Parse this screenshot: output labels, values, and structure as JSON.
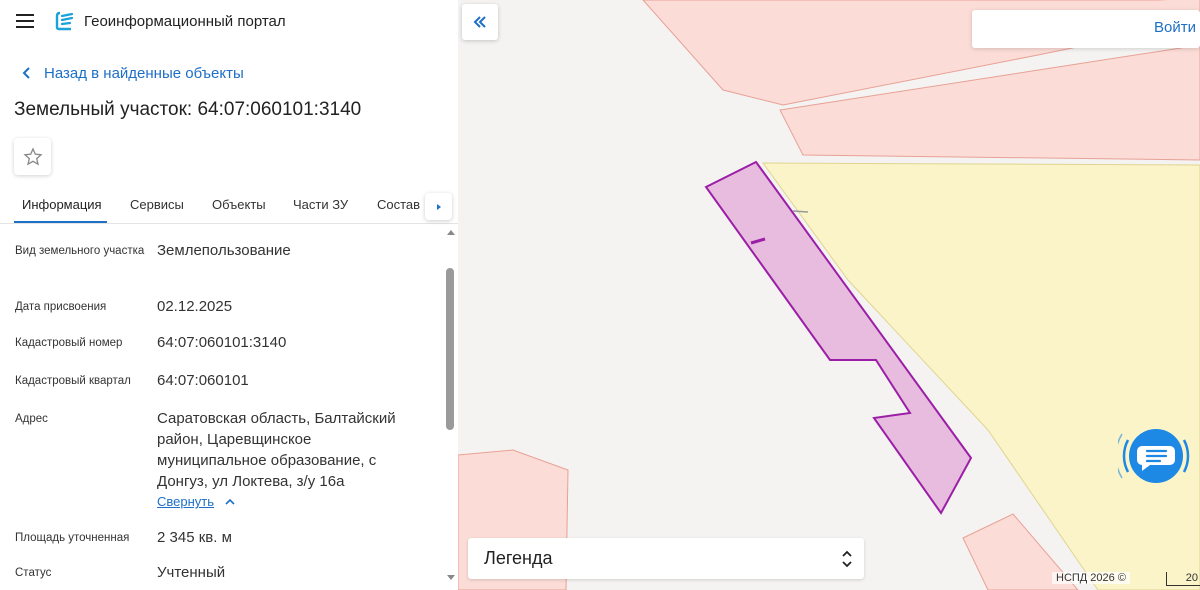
{
  "header": {
    "portal_title": "Геоинформационный портал"
  },
  "nav": {
    "back_label": "Назад в найденные объекты"
  },
  "object": {
    "title": "Земельный участок: 64:07:060101:3140"
  },
  "tabs": [
    {
      "label": "Информация",
      "active": true
    },
    {
      "label": "Сервисы",
      "active": false
    },
    {
      "label": "Объекты",
      "active": false
    },
    {
      "label": "Части ЗУ",
      "active": false
    },
    {
      "label": "Состав",
      "active": false
    }
  ],
  "properties": [
    {
      "label": "Вид земельного участка",
      "value": "Землепользование"
    },
    {
      "label": "Дата присвоения",
      "value": "02.12.2025"
    },
    {
      "label": "Кадастровый номер",
      "value": "64:07:060101:3140"
    },
    {
      "label": "Кадастровый квартал",
      "value": "64:07:060101"
    },
    {
      "label": "Адрес",
      "value": "Саратовская область, Балтайский район, Царевщинское муниципальное образование, с Донгуз, ул Локтева, з/у 16а"
    },
    {
      "label": "Площадь уточненная",
      "value": "2 345 кв. м"
    },
    {
      "label": "Статус",
      "value": "Учтенный"
    }
  ],
  "collapse_label": "Свернуть",
  "map": {
    "login_label": "Войти",
    "legend_label": "Легенда",
    "copyright": "НСПД 2026 ©",
    "scale_label": "20"
  },
  "colors": {
    "accent": "#1e6fc7",
    "parcel_fill": "#e8bcdf",
    "parcel_stroke": "#9b1fa6",
    "zone_yellow": "#faf4c8",
    "zone_pink": "#fbdcd6"
  }
}
